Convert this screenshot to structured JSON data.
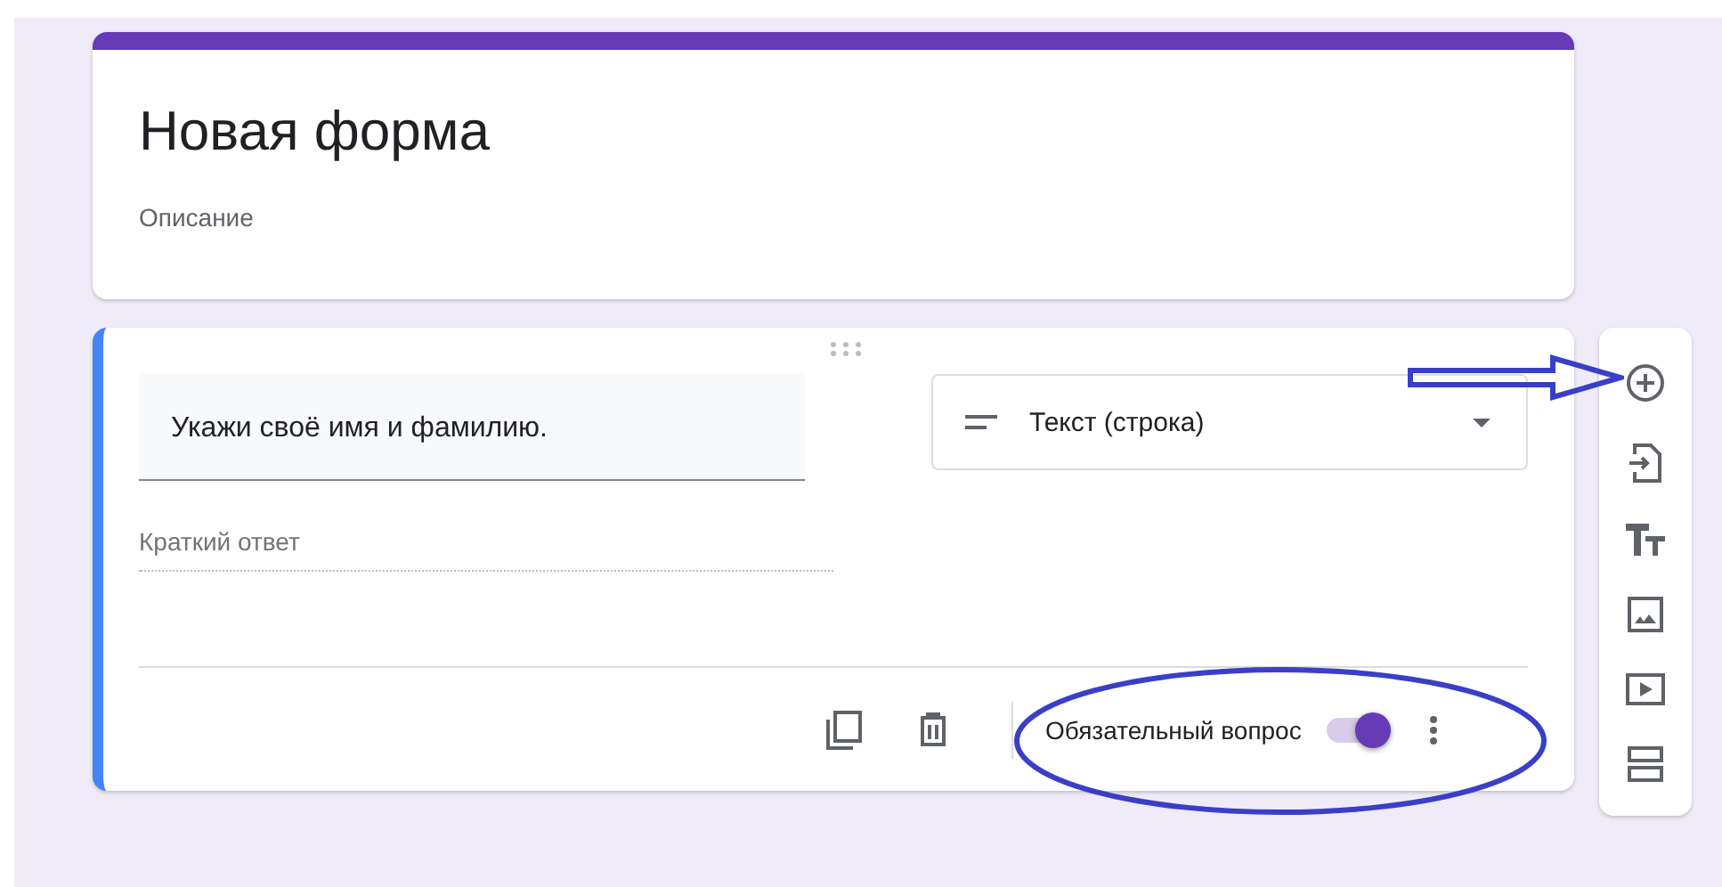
{
  "form_header": {
    "title": "Новая форма",
    "description": "Описание"
  },
  "question": {
    "title": "Укажи своё имя и фамилию.",
    "type": "Текст (строка)",
    "answer_placeholder": "Краткий ответ",
    "required_label": "Обязательный вопрос",
    "required": true
  }
}
